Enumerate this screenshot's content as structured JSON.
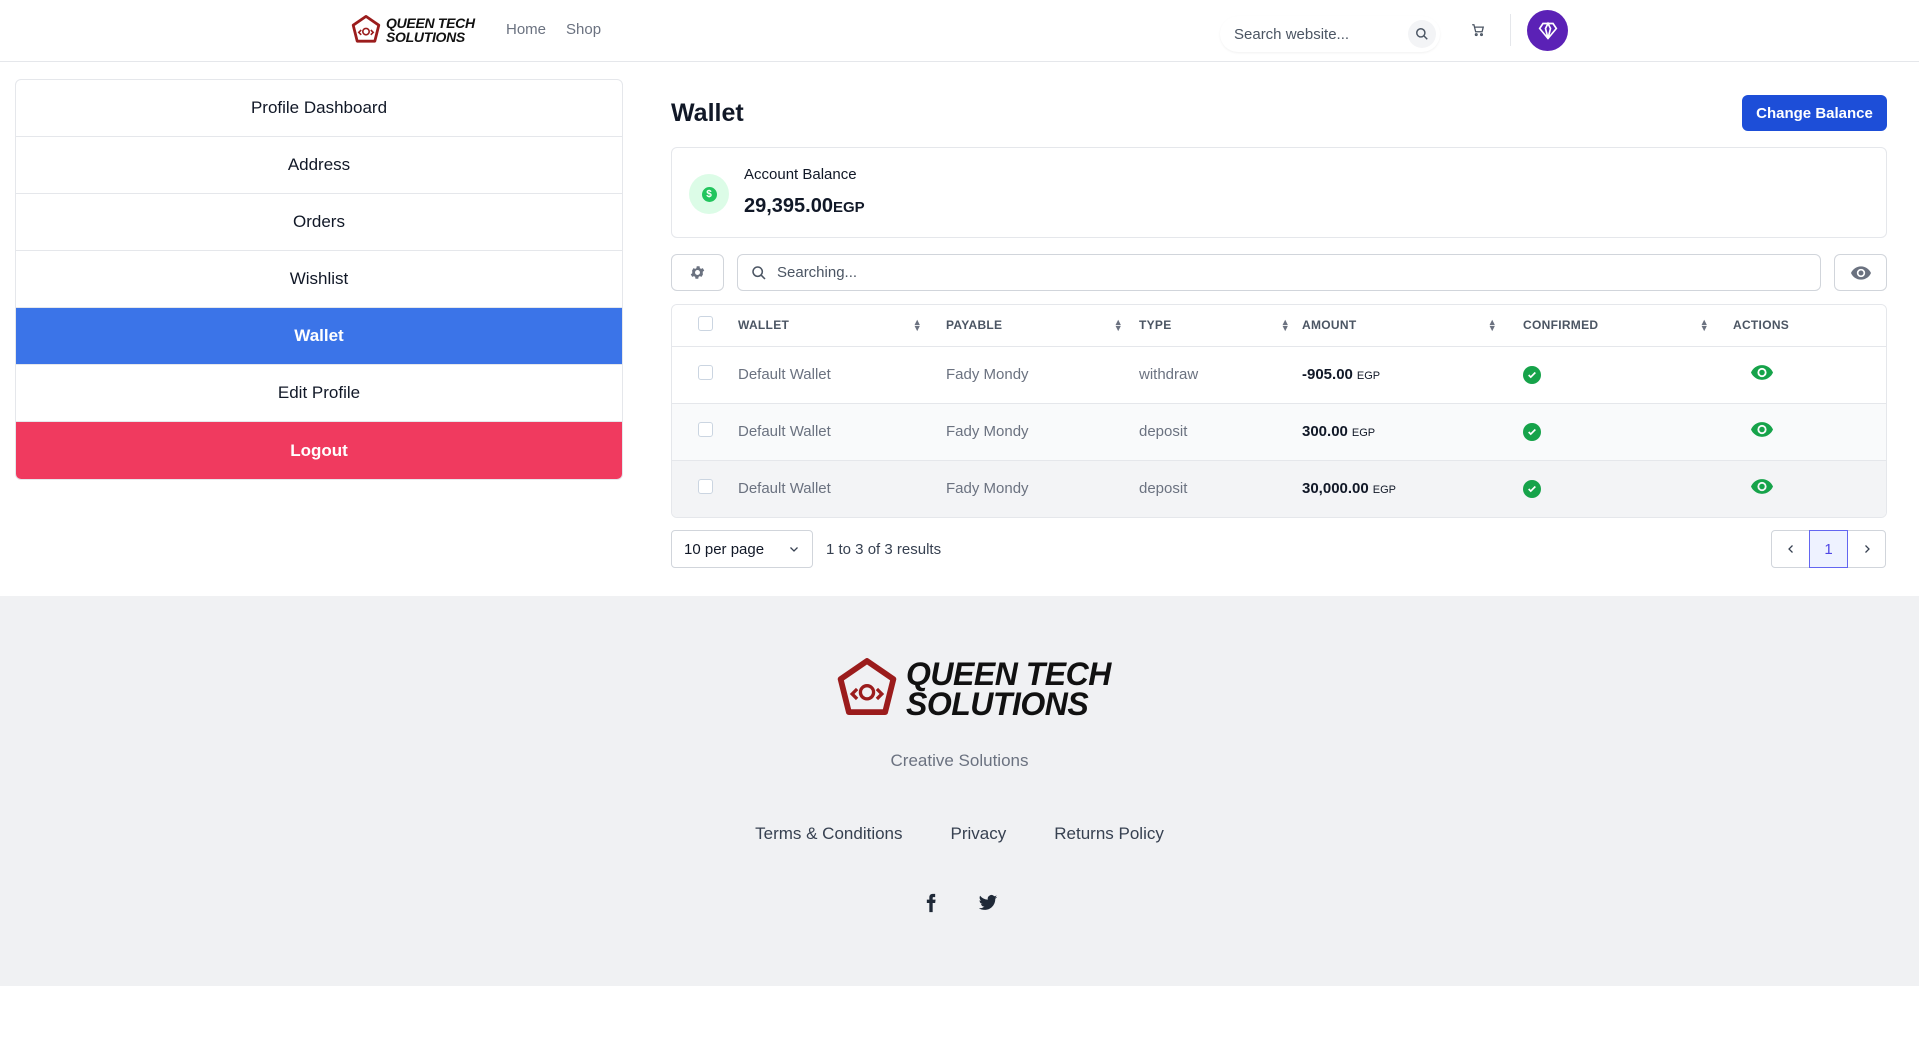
{
  "header": {
    "logo_text_line1": "QUEEN TECH",
    "logo_text_line2": "SOLUTIONS",
    "nav": [
      "Home",
      "Shop"
    ],
    "search_placeholder": "Search website..."
  },
  "sidebar": {
    "items": [
      {
        "label": "Profile Dashboard"
      },
      {
        "label": "Address"
      },
      {
        "label": "Orders"
      },
      {
        "label": "Wishlist"
      },
      {
        "label": "Wallet"
      },
      {
        "label": "Edit Profile"
      },
      {
        "label": "Logout"
      }
    ]
  },
  "main": {
    "title": "Wallet",
    "change_balance_label": "Change Balance",
    "balance": {
      "label": "Account Balance",
      "value": "29,395.00",
      "currency": "EGP"
    },
    "table_search_placeholder": "Searching...",
    "columns": [
      "WALLET",
      "PAYABLE",
      "TYPE",
      "AMOUNT",
      "CONFIRMED",
      "ACTIONS"
    ],
    "rows": [
      {
        "wallet": "Default Wallet",
        "payable": "Fady Mondy",
        "type": "withdraw",
        "amount": "-905.00",
        "currency": "EGP"
      },
      {
        "wallet": "Default Wallet",
        "payable": "Fady Mondy",
        "type": "deposit",
        "amount": "300.00",
        "currency": "EGP"
      },
      {
        "wallet": "Default Wallet",
        "payable": "Fady Mondy",
        "type": "deposit",
        "amount": "30,000.00",
        "currency": "EGP"
      }
    ],
    "per_page": "10 per page",
    "results_text": "1 to 3 of 3 results",
    "current_page": "1"
  },
  "footer": {
    "logo_text_line1": "QUEEN TECH",
    "logo_text_line2": "SOLUTIONS",
    "tagline": "Creative Solutions",
    "links": [
      "Terms & Conditions",
      "Privacy",
      "Returns Policy"
    ],
    "socials": [
      "facebook-icon",
      "twitter-icon"
    ]
  },
  "colors": {
    "primary": "#1d4ed8",
    "active_sidebar": "#3b74e8",
    "logout": "#f03a5f",
    "confirmed": "#16a34a",
    "avatar": "#5b21b6",
    "logo": "#9b1c1c"
  }
}
